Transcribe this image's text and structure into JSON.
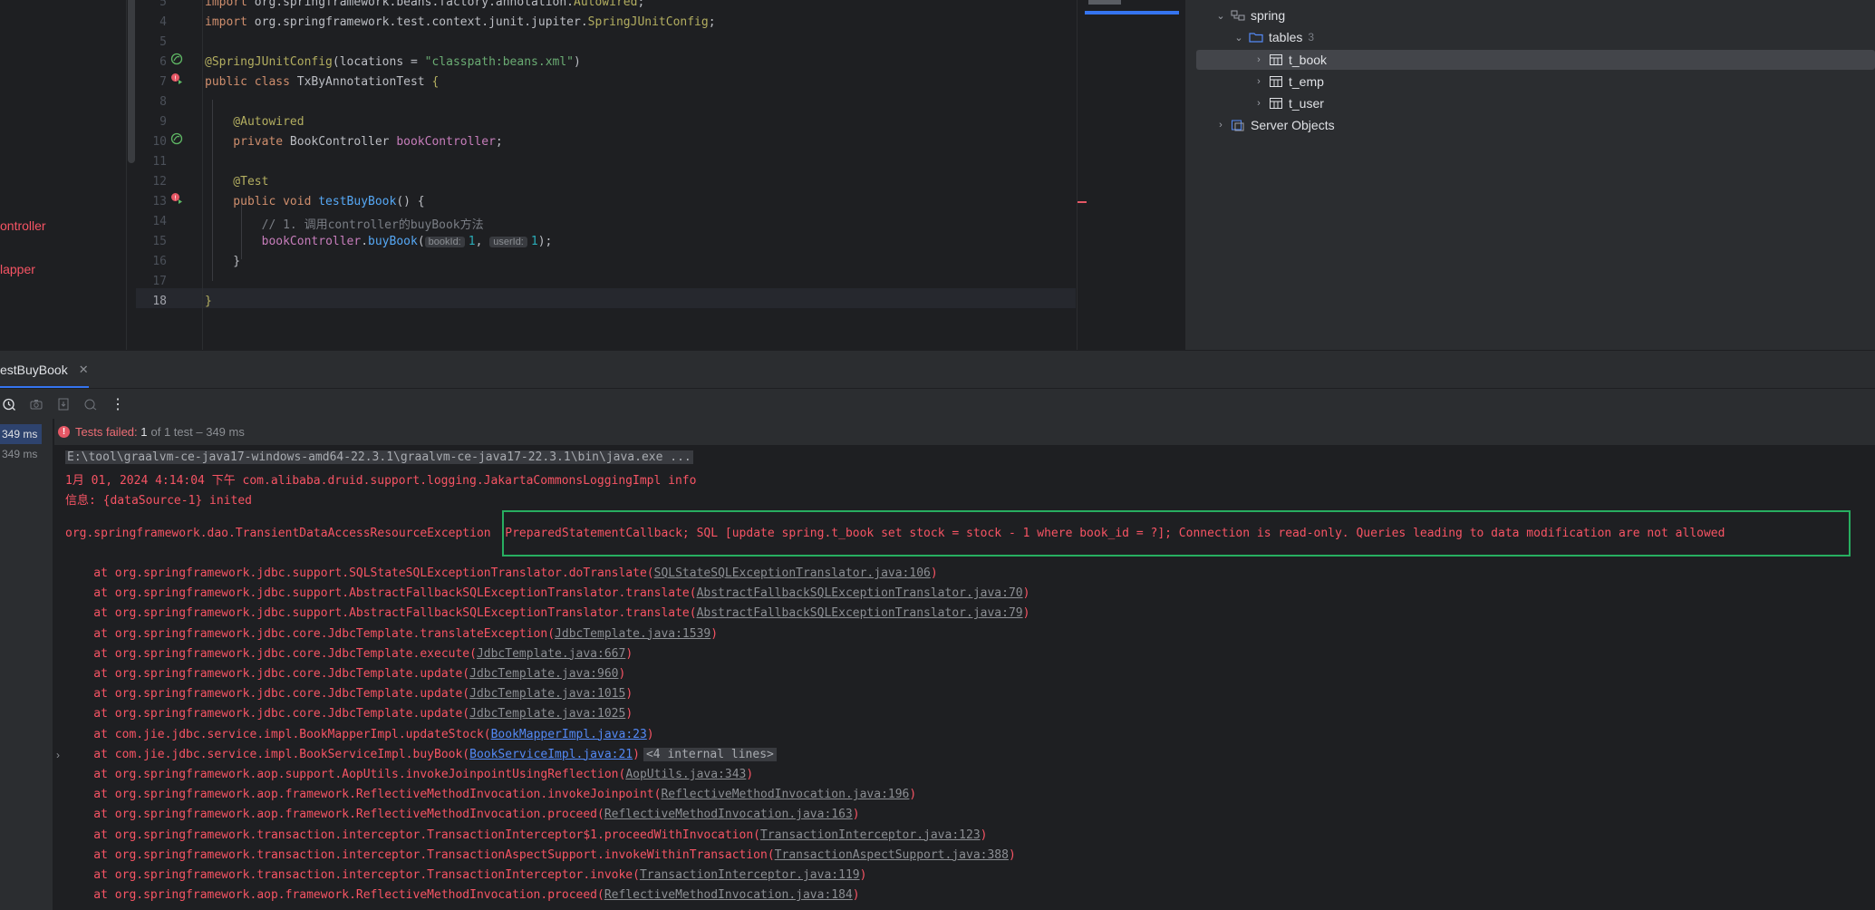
{
  "project_strip": {
    "items": [
      {
        "label": "ontroller"
      },
      {
        "label": "lapper"
      }
    ]
  },
  "editor": {
    "lines": [
      {
        "n": "5",
        "segments": [
          {
            "t": "import ",
            "c": "kw"
          },
          {
            "t": "org.springframework.beans.factory.annotation.",
            "c": ""
          },
          {
            "t": "Autowired",
            "c": "an"
          },
          {
            "t": ";",
            "c": ""
          }
        ]
      },
      {
        "n": "4",
        "segments": [
          {
            "t": "import ",
            "c": "kw"
          },
          {
            "t": "org.springframework.test.context.junit.jupiter.",
            "c": ""
          },
          {
            "t": "SpringJUnitConfig",
            "c": "an"
          },
          {
            "t": ";",
            "c": ""
          }
        ]
      },
      {
        "n": "5",
        "segments": []
      },
      {
        "n": "6",
        "segments": [
          {
            "t": "@SpringJUnitConfig",
            "c": "an"
          },
          {
            "t": "(locations = ",
            "c": ""
          },
          {
            "t": "\"classpath:beans.xml\"",
            "c": "str"
          },
          {
            "t": ")",
            "c": ""
          }
        ]
      },
      {
        "n": "7",
        "segments": [
          {
            "t": "public class ",
            "c": "kw"
          },
          {
            "t": "TxByAnnotationTest ",
            "c": ""
          },
          {
            "t": "{",
            "c": "an"
          }
        ]
      },
      {
        "n": "8",
        "segments": []
      },
      {
        "n": "9",
        "segments": [
          {
            "t": "    @Autowired",
            "c": "an"
          }
        ]
      },
      {
        "n": "10",
        "segments": [
          {
            "t": "    private ",
            "c": "kw"
          },
          {
            "t": "BookController ",
            "c": ""
          },
          {
            "t": "bookController",
            "c": "fld"
          },
          {
            "t": ";",
            "c": ""
          }
        ]
      },
      {
        "n": "11",
        "segments": []
      },
      {
        "n": "12",
        "segments": [
          {
            "t": "    @Test",
            "c": "an"
          }
        ]
      },
      {
        "n": "13",
        "segments": [
          {
            "t": "    public void ",
            "c": "kw"
          },
          {
            "t": "testBuyBook",
            "c": "fn"
          },
          {
            "t": "() {",
            "c": ""
          }
        ]
      },
      {
        "n": "14",
        "segments": [
          {
            "t": "        // 1. 调用controller的buyBook方法",
            "c": "cm"
          }
        ]
      },
      {
        "n": "15",
        "segments": [
          {
            "t": "        ",
            "c": ""
          },
          {
            "t": "bookController",
            "c": "fld"
          },
          {
            "t": ".",
            "c": ""
          },
          {
            "t": "buyBook",
            "c": "fn"
          },
          {
            "t": "(",
            "c": ""
          },
          {
            "hint": "bookId:"
          },
          {
            "t": "1",
            "c": "num"
          },
          {
            "t": ", ",
            "c": ""
          },
          {
            "hint": "userId:"
          },
          {
            "t": "1",
            "c": "num"
          },
          {
            "t": ");",
            "c": ""
          }
        ]
      },
      {
        "n": "16",
        "segments": [
          {
            "t": "    }",
            "c": ""
          }
        ]
      },
      {
        "n": "17",
        "segments": []
      },
      {
        "n": "18",
        "segments": [
          {
            "t": "}",
            "c": "an"
          }
        ]
      }
    ]
  },
  "db_tree": {
    "schema": "spring",
    "tables_label": "tables",
    "tables_count": "3",
    "tables": [
      "t_book",
      "t_emp",
      "t_user"
    ],
    "server_objects": "Server Objects"
  },
  "run_panel": {
    "tab_label": "estBuyBook",
    "tests_failed_prefix": "Tests failed:",
    "tests_failed_count": "1",
    "tests_failed_suffix": "of 1 test – 349 ms",
    "tree": [
      {
        "label": "349 ms",
        "selected": true
      },
      {
        "label": "349 ms",
        "selected": false
      }
    ]
  },
  "console": {
    "cmd": "E:\\tool\\graalvm-ce-java17-windows-amd64-22.3.1\\graalvm-ce-java17-22.3.1\\bin\\java.exe ...",
    "log1": "1月 01, 2024 4:14:04 下午 com.alibaba.druid.support.logging.JakartaCommonsLoggingImpl info",
    "log2": "信息: {dataSource-1} inited",
    "exception": "org.springframework.dao.TransientDataAccessResourceException",
    "exception_msg": "PreparedStatementCallback; SQL [update spring.t_book set stock = stock - 1 where book_id = ?]; Connection is read-only. Queries leading to data modification are not allowed",
    "frames": [
      {
        "at": "    at org.springframework.jdbc.support.SQLStateSQLExceptionTranslator.doTranslate(",
        "link": "SQLStateSQLExceptionTranslator.java:106",
        "blue": false,
        "end": ")",
        "internal": ""
      },
      {
        "at": "    at org.springframework.jdbc.support.AbstractFallbackSQLExceptionTranslator.translate(",
        "link": "AbstractFallbackSQLExceptionTranslator.java:70",
        "blue": false,
        "end": ")",
        "internal": ""
      },
      {
        "at": "    at org.springframework.jdbc.support.AbstractFallbackSQLExceptionTranslator.translate(",
        "link": "AbstractFallbackSQLExceptionTranslator.java:79",
        "blue": false,
        "end": ")",
        "internal": ""
      },
      {
        "at": "    at org.springframework.jdbc.core.JdbcTemplate.translateException(",
        "link": "JdbcTemplate.java:1539",
        "blue": false,
        "end": ")",
        "internal": ""
      },
      {
        "at": "    at org.springframework.jdbc.core.JdbcTemplate.execute(",
        "link": "JdbcTemplate.java:667",
        "blue": false,
        "end": ")",
        "internal": ""
      },
      {
        "at": "    at org.springframework.jdbc.core.JdbcTemplate.update(",
        "link": "JdbcTemplate.java:960",
        "blue": false,
        "end": ")",
        "internal": ""
      },
      {
        "at": "    at org.springframework.jdbc.core.JdbcTemplate.update(",
        "link": "JdbcTemplate.java:1015",
        "blue": false,
        "end": ")",
        "internal": ""
      },
      {
        "at": "    at org.springframework.jdbc.core.JdbcTemplate.update(",
        "link": "JdbcTemplate.java:1025",
        "blue": false,
        "end": ")",
        "internal": ""
      },
      {
        "at": "    at com.jie.jdbc.service.impl.BookMapperImpl.updateStock(",
        "link": "BookMapperImpl.java:23",
        "blue": true,
        "end": ")",
        "internal": ""
      },
      {
        "at": "    at com.jie.jdbc.service.impl.BookServiceImpl.buyBook(",
        "link": "BookServiceImpl.java:21",
        "blue": true,
        "end": ")",
        "internal": "<4 internal lines>"
      },
      {
        "at": "    at org.springframework.aop.support.AopUtils.invokeJoinpointUsingReflection(",
        "link": "AopUtils.java:343",
        "blue": false,
        "end": ")",
        "internal": ""
      },
      {
        "at": "    at org.springframework.aop.framework.ReflectiveMethodInvocation.invokeJoinpoint(",
        "link": "ReflectiveMethodInvocation.java:196",
        "blue": false,
        "end": ")",
        "internal": ""
      },
      {
        "at": "    at org.springframework.aop.framework.ReflectiveMethodInvocation.proceed(",
        "link": "ReflectiveMethodInvocation.java:163",
        "blue": false,
        "end": ")",
        "internal": ""
      },
      {
        "at": "    at org.springframework.transaction.interceptor.TransactionInterceptor$1.proceedWithInvocation(",
        "link": "TransactionInterceptor.java:123",
        "blue": false,
        "end": ")",
        "internal": ""
      },
      {
        "at": "    at org.springframework.transaction.interceptor.TransactionAspectSupport.invokeWithinTransaction(",
        "link": "TransactionAspectSupport.java:388",
        "blue": false,
        "end": ")",
        "internal": ""
      },
      {
        "at": "    at org.springframework.transaction.interceptor.TransactionInterceptor.invoke(",
        "link": "TransactionInterceptor.java:119",
        "blue": false,
        "end": ")",
        "internal": ""
      },
      {
        "at": "    at org.springframework.aop.framework.ReflectiveMethodInvocation.proceed(",
        "link": "ReflectiveMethodInvocation.java:184",
        "blue": false,
        "end": ")",
        "internal": ""
      }
    ]
  },
  "colors": {
    "error_red": "#f75464",
    "highlight_green": "#27ae60",
    "accent_blue": "#3574f0"
  }
}
